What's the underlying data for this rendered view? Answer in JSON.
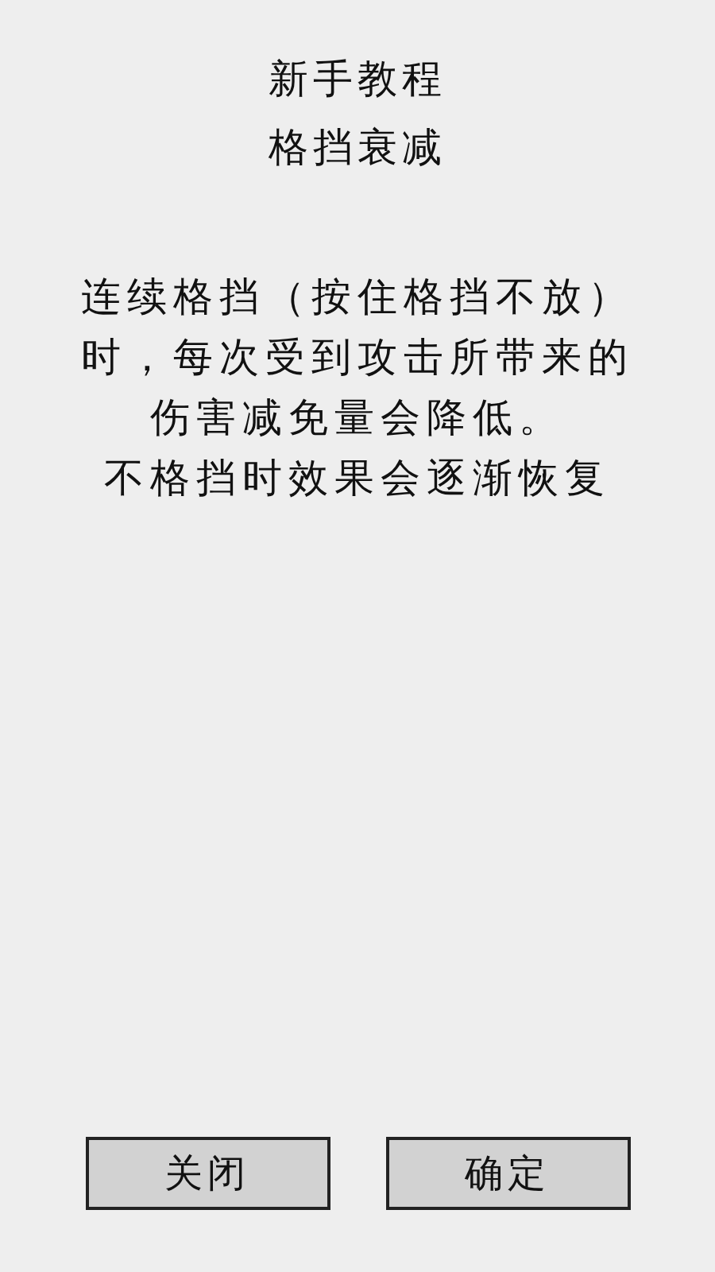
{
  "header": {
    "title": "新手教程",
    "subtitle": "格挡衰减"
  },
  "description_lines": [
    "连续格挡（按住格挡不放）",
    "时，每次受到攻击所带来的",
    "伤害减免量会降低。",
    "不格挡时效果会逐渐恢复"
  ],
  "buttons": [
    {
      "label": "关闭"
    },
    {
      "label": "确定"
    }
  ]
}
